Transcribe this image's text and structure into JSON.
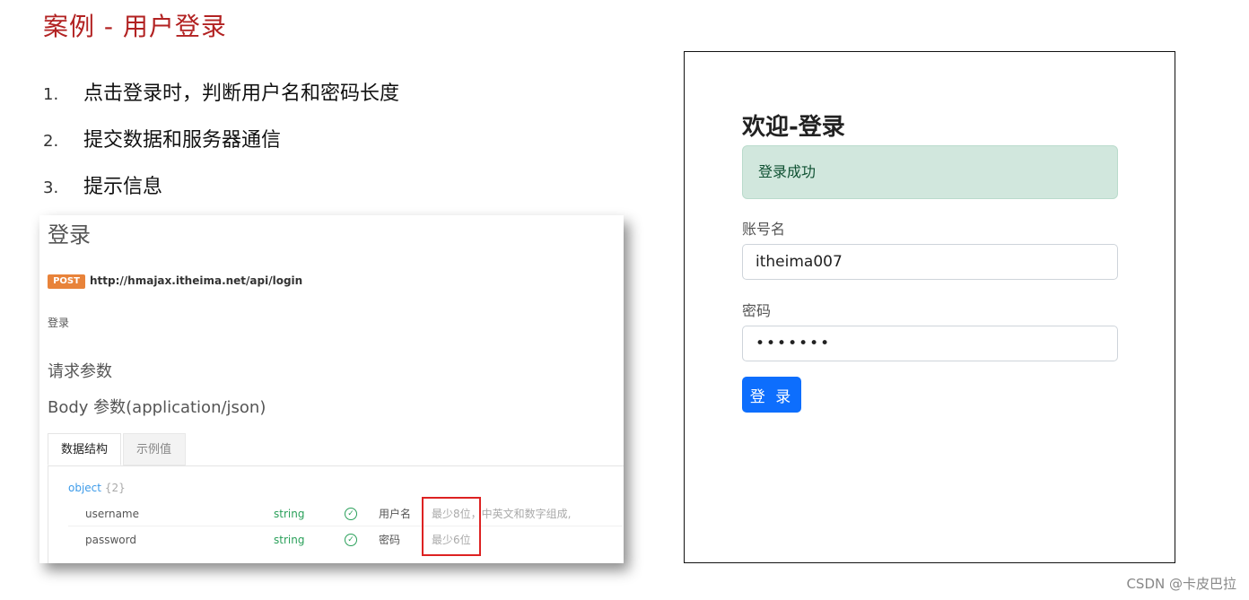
{
  "slide": {
    "title": "案例 - 用户登录",
    "steps": [
      {
        "num": "1.",
        "text": "点击登录时，判断用户名和密码长度"
      },
      {
        "num": "2.",
        "text": "提交数据和服务器通信"
      },
      {
        "num": "3.",
        "text": "提示信息"
      }
    ]
  },
  "api_doc": {
    "title": "登录",
    "method": "POST",
    "url": "http://hmajax.itheima.net/api/login",
    "description": "登录",
    "request_params_heading": "请求参数",
    "body_params_heading": "Body 参数(application/json)",
    "tabs": [
      {
        "label": "数据结构"
      },
      {
        "label": "示例值"
      }
    ],
    "object_label": "object",
    "object_count": "{2}",
    "fields": [
      {
        "name": "username",
        "type": "string",
        "label": "用户名",
        "note": "最少8位，中英文和数字组成,"
      },
      {
        "name": "password",
        "type": "string",
        "label": "密码",
        "note": "最少6位"
      }
    ]
  },
  "login_form": {
    "heading": "欢迎-登录",
    "alert": "登录成功",
    "username_label": "账号名",
    "username_value": "itheima007",
    "password_label": "密码",
    "password_value": "•••••••",
    "submit_label": "登 录"
  },
  "watermark": "CSDN @卡皮巴拉",
  "colors": {
    "title_red": "#b22222",
    "post_orange": "#e8833a",
    "type_green": "#2aa05a",
    "link_blue": "#3d9be9",
    "alert_bg": "#d1e7dd",
    "button_blue": "#0d6efd",
    "highlight_red": "#dd2222"
  }
}
